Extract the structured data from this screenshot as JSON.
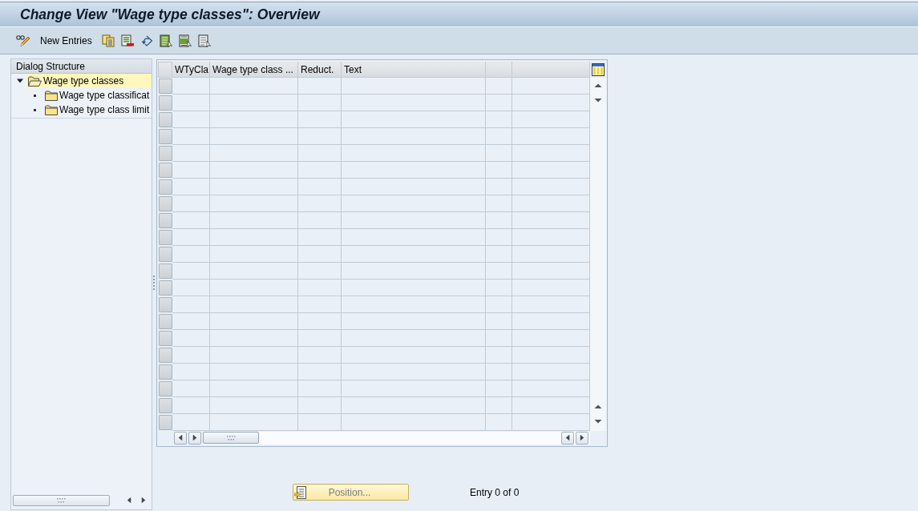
{
  "window": {
    "title": "Change View \"Wage type classes\": Overview"
  },
  "toolbar": {
    "new_entries": "New Entries"
  },
  "dialog_structure": {
    "title": "Dialog Structure",
    "tree": [
      {
        "label": "Wage type classes",
        "expanded": true,
        "selected": true,
        "children": [
          {
            "label": "Wage type classificat",
            "selected": false
          },
          {
            "label": "Wage type class limit",
            "selected": false
          }
        ]
      }
    ]
  },
  "table": {
    "columns": [
      {
        "kind": "text",
        "label": "WTyCla"
      },
      {
        "kind": "text",
        "label": "Wage type class ..."
      },
      {
        "kind": "text",
        "label": "Reduct."
      },
      {
        "kind": "text",
        "label": "Text"
      },
      {
        "kind": "blank"
      },
      {
        "kind": "blank"
      }
    ]
  },
  "footer": {
    "position_button": "Position...",
    "entry_count": "Entry 0 of 0"
  }
}
